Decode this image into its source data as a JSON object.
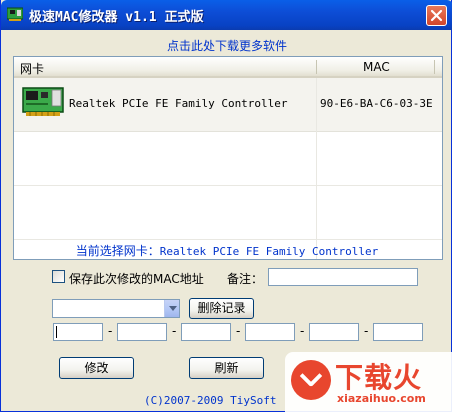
{
  "window": {
    "title": "极速MAC修改器 v1.1 正式版",
    "close_glyph": "✕"
  },
  "download_link": "点击此处下载更多软件",
  "adapter_list": {
    "columns": [
      "网卡",
      "MAC"
    ],
    "rows": [
      {
        "name": "Realtek PCIe FE Family Controller",
        "mac": "90-E6-BA-C6-03-3E",
        "icon": "network-card-icon"
      }
    ]
  },
  "current_selection": {
    "label": "当前选择网卡：",
    "value": "Realtek PCIe FE Family Controller"
  },
  "save_option": {
    "label": "保存此次修改的MAC地址",
    "checked": false
  },
  "remark": {
    "label": "备注：",
    "value": ""
  },
  "history_combo": {
    "value": ""
  },
  "buttons": {
    "delete_record": "删除记录",
    "modify": "修改",
    "refresh": "刷新"
  },
  "mac_input": {
    "fields": [
      "",
      "",
      "",
      "",
      "",
      ""
    ],
    "separator": "-"
  },
  "copyright": "(C)2007-2009 TiySoft",
  "watermark": {
    "brand": "下载火",
    "domain": "xiazaihuo.com",
    "color": "#E8462E"
  },
  "colors": {
    "titlebar": "#0A5FE8",
    "link": "#0033CC",
    "window_bg": "#ECE9D8"
  }
}
